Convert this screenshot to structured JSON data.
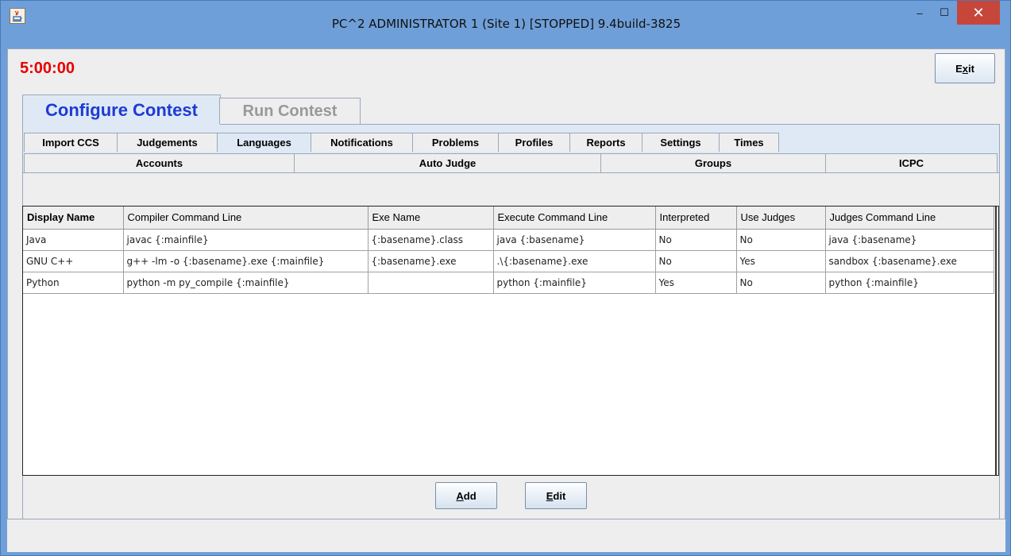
{
  "window": {
    "title": "PC^2 ADMINISTRATOR 1 (Site 1) [STOPPED] 9.4build-3825",
    "minimize_glyph": "–",
    "maximize_glyph": "☐",
    "close_glyph": "✕"
  },
  "header": {
    "clock": "5:00:00",
    "exit_label_prefix": "E",
    "exit_label_mnemonic": "x",
    "exit_label_suffix": "it"
  },
  "main_tabs": [
    {
      "label": "Configure Contest"
    },
    {
      "label": "Run Contest"
    }
  ],
  "sub_tabs_row1": [
    {
      "label": "Import CCS"
    },
    {
      "label": "Judgements"
    },
    {
      "label": "Languages"
    },
    {
      "label": "Notifications"
    },
    {
      "label": "Problems"
    },
    {
      "label": "Profiles"
    },
    {
      "label": "Reports"
    },
    {
      "label": "Settings"
    },
    {
      "label": "Times"
    }
  ],
  "sub_tabs_row2": [
    {
      "label": "Accounts"
    },
    {
      "label": "Auto Judge"
    },
    {
      "label": "Groups"
    },
    {
      "label": "ICPC"
    }
  ],
  "table": {
    "columns": [
      "Display Name",
      "Compiler Command Line",
      "Exe Name",
      "Execute Command Line",
      "Interpreted",
      "Use Judges",
      "Judges Command Line"
    ],
    "rows": [
      [
        "Java",
        "javac {:mainfile}",
        "{:basename}.class",
        "java {:basename}",
        "No",
        "No",
        "java {:basename}"
      ],
      [
        "GNU C++",
        "g++ -lm -o {:basename}.exe {:mainfile}",
        "{:basename}.exe",
        ".\\{:basename}.exe",
        "No",
        "Yes",
        "sandbox {:basename}.exe"
      ],
      [
        "Python",
        "python -m py_compile {:mainfile}",
        "",
        "python {:mainfile}",
        "Yes",
        "No",
        "python {:mainfile}"
      ]
    ]
  },
  "buttons": {
    "add_mnemonic": "A",
    "add_rest": "dd",
    "edit_mnemonic": "E",
    "edit_rest": "dit"
  }
}
